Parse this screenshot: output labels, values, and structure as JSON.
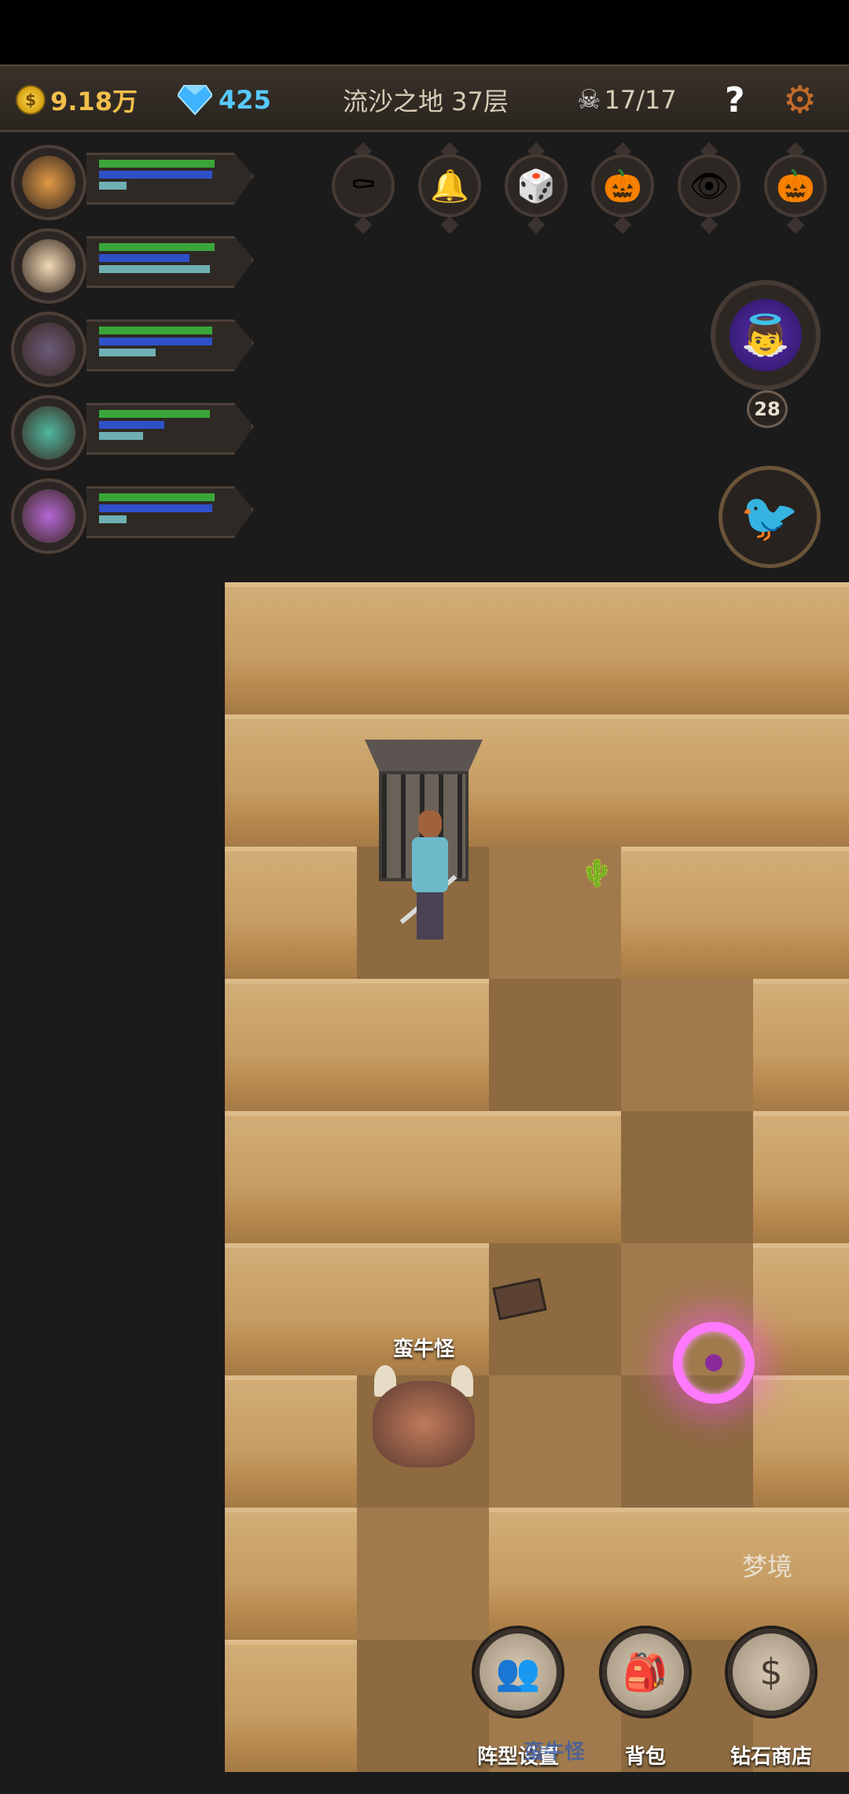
{
  "topbar": {
    "gold": "9.18万",
    "gems": "425",
    "location": "流沙之地 37层",
    "kills": "17/17",
    "help_label": "?"
  },
  "heroes": [
    {
      "name": "hero-1",
      "hp": 0.92,
      "mp": 0.9,
      "xp": 0.22,
      "color": "#e19a45"
    },
    {
      "name": "hero-2",
      "hp": 0.92,
      "mp": 0.72,
      "xp": 0.88,
      "color": "#f0d9b5"
    },
    {
      "name": "hero-3",
      "hp": 0.9,
      "mp": 0.9,
      "xp": 0.45,
      "color": "#6b5a7a"
    },
    {
      "name": "hero-4",
      "hp": 0.88,
      "mp": 0.52,
      "xp": 0.35,
      "color": "#4fb8a0"
    },
    {
      "name": "hero-5",
      "hp": 0.92,
      "mp": 0.9,
      "xp": 0.22,
      "color": "#b566d6"
    }
  ],
  "relics": [
    "coffin-icon",
    "bell-icon",
    "dice-icon",
    "pumpkin-icon",
    "eyeball-icon",
    "pumpkin-icon"
  ],
  "companion": {
    "level": "28"
  },
  "map": {
    "monster_name": "蛮牛怪"
  },
  "nav": {
    "dream": "梦境",
    "formation": "阵型设置",
    "bag": "背包",
    "shop": "钻石商店",
    "ghost_label": "蛮牛怪"
  }
}
